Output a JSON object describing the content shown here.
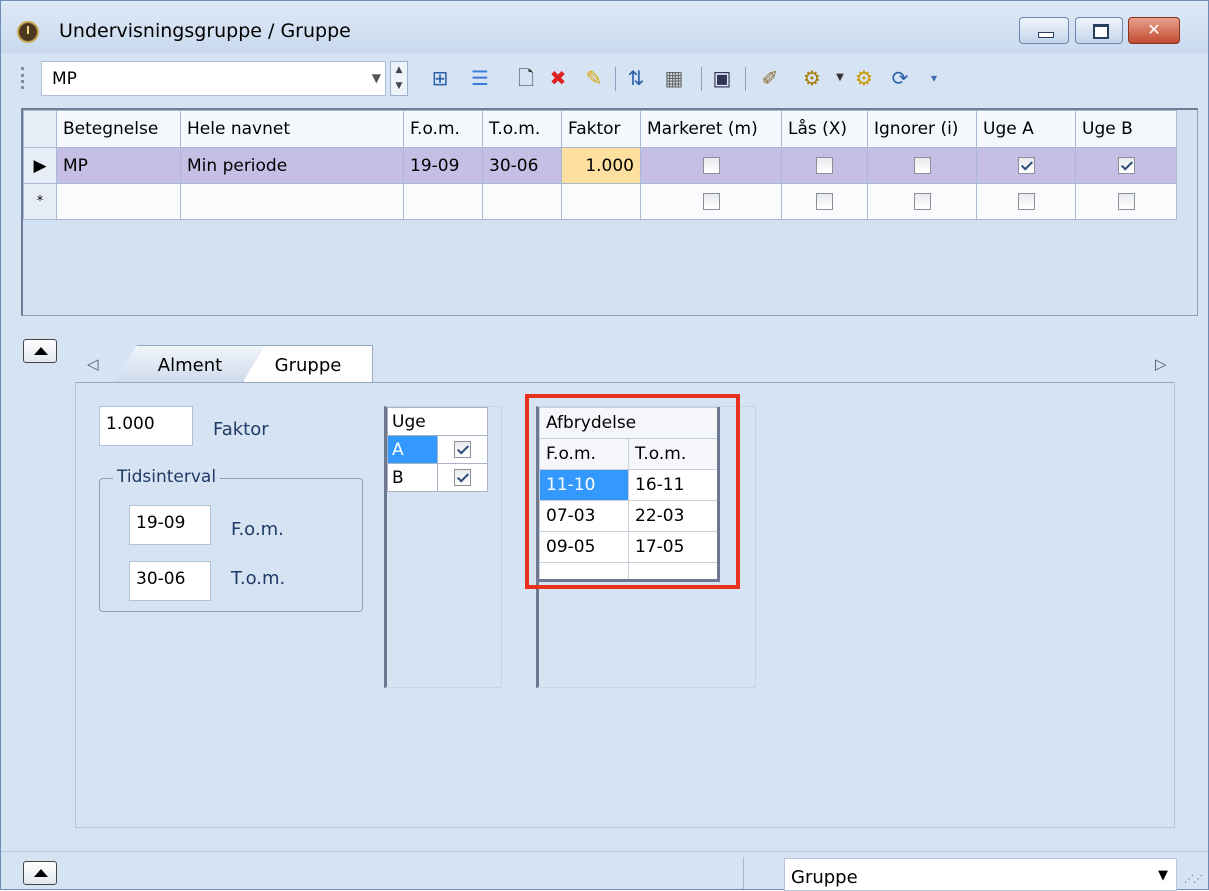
{
  "window": {
    "title": "Undervisningsgruppe / Gruppe",
    "close_label": "✕"
  },
  "toolbar": {
    "combo_value": "MP"
  },
  "grid": {
    "headers": [
      "Betegnelse",
      "Hele navnet",
      "F.o.m.",
      "T.o.m.",
      "Faktor",
      "Markeret (m)",
      "Lås (X)",
      "Ignorer (i)",
      "Uge A",
      "Uge B"
    ],
    "rows": [
      {
        "indicator": "▶",
        "betegnelse": "MP",
        "hele_navnet": "Min periode",
        "fom": "19-09",
        "tom": "30-06",
        "faktor": "1.000",
        "markeret": false,
        "laas": false,
        "ignorer": false,
        "uge_a": true,
        "uge_b": true
      },
      {
        "indicator": "*",
        "betegnelse": "",
        "hele_navnet": "",
        "fom": "",
        "tom": "",
        "faktor": "",
        "markeret": false,
        "laas": false,
        "ignorer": false,
        "uge_a": false,
        "uge_b": false
      }
    ]
  },
  "tabs": [
    {
      "label": "Alment",
      "active": false
    },
    {
      "label": "Gruppe",
      "active": true
    }
  ],
  "form": {
    "faktor_value": "1.000",
    "faktor_label": "Faktor",
    "tidsinterval_label": "Tidsinterval",
    "fom_value": "19-09",
    "fom_label": "F.o.m.",
    "tom_value": "30-06",
    "tom_label": "T.o.m."
  },
  "uge": {
    "header": "Uge",
    "rows": [
      {
        "label": "A",
        "checked": true
      },
      {
        "label": "B",
        "checked": true
      }
    ]
  },
  "afbrydelse": {
    "header": "Afbrydelse",
    "col_fom": "F.o.m.",
    "col_tom": "T.o.m.",
    "rows": [
      [
        "11-10",
        "16-11"
      ],
      [
        "07-03",
        "22-03"
      ],
      [
        "09-05",
        "17-05"
      ],
      [
        "",
        ""
      ]
    ]
  },
  "statusbar": {
    "combo_value": "Gruppe"
  },
  "colors": {
    "highlight_box": "#e8321d",
    "selected_row": "#c5bfe6",
    "faktor_cell": "#fddf9f",
    "selection": "#3399ff"
  }
}
